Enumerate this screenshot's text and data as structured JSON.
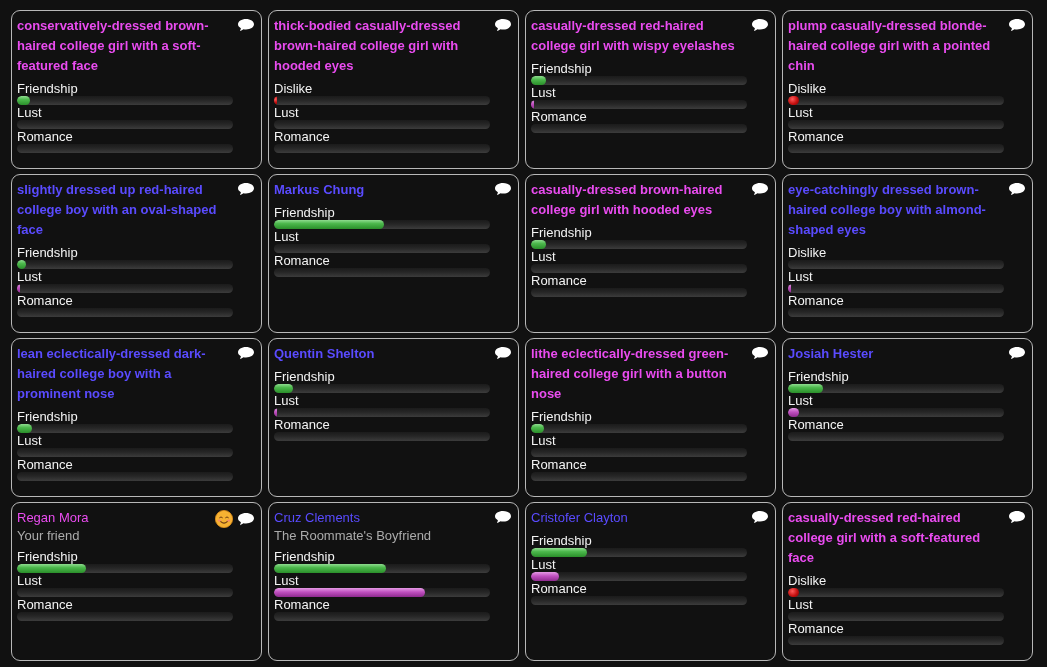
{
  "cards": [
    {
      "title": "conservatively-dressed brown-haired college girl with a soft-featured face",
      "color": "#ea4cf0",
      "highlighted": true,
      "happy": false,
      "meters": [
        {
          "kind": "friendship",
          "label": "Friendship",
          "level": 0.06
        },
        {
          "kind": "lust",
          "label": "Lust"
        },
        {
          "kind": "romance",
          "label": "Romance"
        }
      ]
    },
    {
      "title": "thick-bodied casually-dressed brown-haired college girl with hooded eyes",
      "color": "#ea4cf0",
      "highlighted": true,
      "happy": false,
      "meters": [
        {
          "kind": "dislike",
          "label": "Dislike",
          "level": 0.015
        },
        {
          "kind": "lust",
          "label": "Lust"
        },
        {
          "kind": "romance",
          "label": "Romance"
        }
      ]
    },
    {
      "title": "casually-dressed red-haired college girl with wispy eyelashes",
      "color": "#ea4cf0",
      "highlighted": true,
      "happy": false,
      "meters": [
        {
          "kind": "friendship",
          "label": "Friendship",
          "level": 0.07
        },
        {
          "kind": "lust",
          "label": "Lust",
          "level": 0.012
        },
        {
          "kind": "romance",
          "label": "Romance"
        }
      ]
    },
    {
      "title": "plump casually-dressed blonde-haired college girl with a pointed chin",
      "color": "#ea4cf0",
      "highlighted": true,
      "happy": false,
      "meters": [
        {
          "kind": "dislike",
          "label": "Dislike",
          "level": 0.05
        },
        {
          "kind": "lust",
          "label": "Lust"
        },
        {
          "kind": "romance",
          "label": "Romance"
        }
      ]
    },
    {
      "title": "slightly dressed up red-haired college boy with an oval-shaped face",
      "color": "#5a4bff",
      "highlighted": true,
      "happy": false,
      "meters": [
        {
          "kind": "friendship",
          "label": "Friendship",
          "level": 0.04
        },
        {
          "kind": "lust",
          "label": "Lust",
          "level": 0.015
        },
        {
          "kind": "romance",
          "label": "Romance"
        }
      ]
    },
    {
      "title": "Markus Chung",
      "color": "#5a4bff",
      "highlighted": true,
      "happy": false,
      "meters": [
        {
          "kind": "friendship",
          "label": "Friendship",
          "level": 0.51
        },
        {
          "kind": "lust",
          "label": "Lust"
        },
        {
          "kind": "romance",
          "label": "Romance"
        }
      ]
    },
    {
      "title": "casually-dressed brown-haired college girl with hooded eyes",
      "color": "#ea4cf0",
      "highlighted": true,
      "happy": false,
      "meters": [
        {
          "kind": "friendship",
          "label": "Friendship",
          "level": 0.07
        },
        {
          "kind": "lust",
          "label": "Lust"
        },
        {
          "kind": "romance",
          "label": "Romance"
        }
      ]
    },
    {
      "title": "eye-catchingly dressed brown-haired college boy with almond-shaped eyes",
      "color": "#5a4bff",
      "highlighted": true,
      "happy": false,
      "meters": [
        {
          "kind": "dislike",
          "label": "Dislike"
        },
        {
          "kind": "lust",
          "label": "Lust",
          "level": 0.015
        },
        {
          "kind": "romance",
          "label": "Romance"
        }
      ]
    },
    {
      "title": "lean eclectically-dressed dark-haired college boy with a prominent nose",
      "color": "#5a4bff",
      "highlighted": true,
      "happy": false,
      "meters": [
        {
          "kind": "friendship",
          "label": "Friendship",
          "level": 0.07
        },
        {
          "kind": "lust",
          "label": "Lust"
        },
        {
          "kind": "romance",
          "label": "Romance"
        }
      ]
    },
    {
      "title": "Quentin Shelton",
      "color": "#5a4bff",
      "highlighted": true,
      "happy": false,
      "meters": [
        {
          "kind": "friendship",
          "label": "Friendship",
          "level": 0.09
        },
        {
          "kind": "lust",
          "label": "Lust",
          "level": 0.012
        },
        {
          "kind": "romance",
          "label": "Romance"
        }
      ]
    },
    {
      "title": "lithe eclectically-dressed green-haired college girl with a button nose",
      "color": "#ea4cf0",
      "highlighted": true,
      "happy": false,
      "meters": [
        {
          "kind": "friendship",
          "label": "Friendship",
          "level": 0.06
        },
        {
          "kind": "lust",
          "label": "Lust"
        },
        {
          "kind": "romance",
          "label": "Romance"
        }
      ]
    },
    {
      "title": "Josiah Hester",
      "color": "#5a4bff",
      "highlighted": true,
      "happy": false,
      "meters": [
        {
          "kind": "friendship",
          "label": "Friendship",
          "level": 0.16
        },
        {
          "kind": "lust",
          "label": "Lust",
          "level": 0.05
        },
        {
          "kind": "romance",
          "label": "Romance"
        }
      ]
    },
    {
      "title": "Regan Mora",
      "subtitle": "Your friend",
      "color": "#ea4cf0",
      "highlighted": false,
      "happy": true,
      "meters": [
        {
          "kind": "friendship",
          "label": "Friendship",
          "level": 0.32
        },
        {
          "kind": "lust",
          "label": "Lust"
        },
        {
          "kind": "romance",
          "label": "Romance"
        }
      ]
    },
    {
      "title": "Cruz Clements",
      "subtitle": "The Roommate's Boyfriend",
      "color": "#5a4bff",
      "highlighted": false,
      "happy": false,
      "meters": [
        {
          "kind": "friendship",
          "label": "Friendship",
          "level": 0.52
        },
        {
          "kind": "lust",
          "label": "Lust",
          "level": 0.7
        },
        {
          "kind": "romance",
          "label": "Romance"
        }
      ]
    },
    {
      "title": "Cristofer Clayton",
      "color": "#5a4bff",
      "highlighted": false,
      "happy": false,
      "meters": [
        {
          "kind": "friendship",
          "label": "Friendship",
          "level": 0.26
        },
        {
          "kind": "lust",
          "label": "Lust",
          "level": 0.13
        },
        {
          "kind": "romance",
          "label": "Romance"
        }
      ]
    },
    {
      "title": "casually-dressed red-haired college girl with a soft-featured face",
      "color": "#ea4cf0",
      "highlighted": true,
      "happy": false,
      "meters": [
        {
          "kind": "dislike",
          "label": "Dislike",
          "level": 0.05
        },
        {
          "kind": "lust",
          "label": "Lust"
        },
        {
          "kind": "romance",
          "label": "Romance"
        }
      ]
    }
  ]
}
